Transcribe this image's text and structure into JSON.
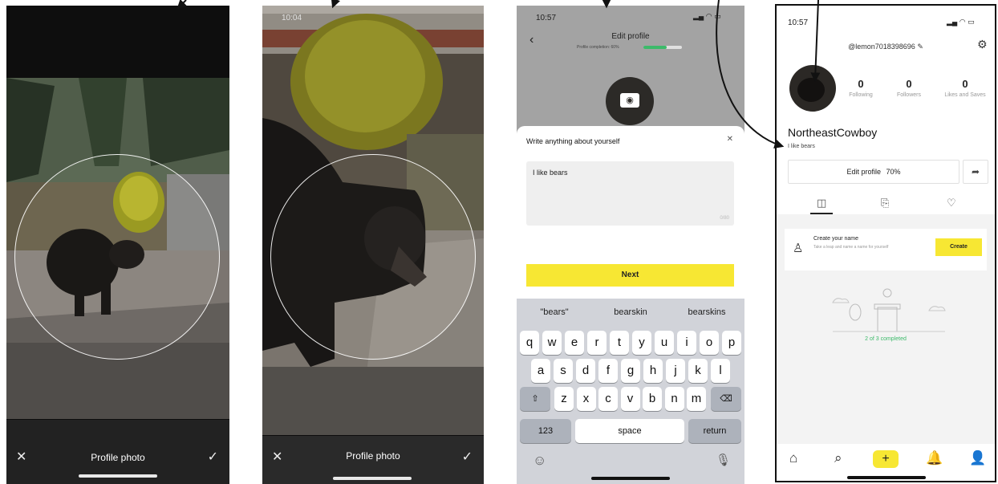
{
  "screen1": {
    "title": "Profile photo",
    "cancel_icon": "close-icon",
    "confirm_icon": "checkmark-icon"
  },
  "screen2": {
    "status_time": "10:04",
    "title": "Profile photo"
  },
  "screen3": {
    "status_time": "10:57",
    "header_title": "Edit profile",
    "header_subtitle": "Profile completion: 60%",
    "progress": 0.6,
    "sheet_title": "Write anything about yourself",
    "bio_value": "I like bears",
    "char_count": "0/80",
    "next_label": "Next",
    "suggestions": [
      "\"bears\"",
      "bearskin",
      "bearskins"
    ],
    "keys_row1": [
      "q",
      "w",
      "e",
      "r",
      "t",
      "y",
      "u",
      "i",
      "o",
      "p"
    ],
    "keys_row2": [
      "a",
      "s",
      "d",
      "f",
      "g",
      "h",
      "j",
      "k",
      "l"
    ],
    "keys_row3": [
      "z",
      "x",
      "c",
      "v",
      "b",
      "n",
      "m"
    ],
    "key_numbers": "123",
    "key_space": "space",
    "key_return": "return"
  },
  "screen4": {
    "status_time": "10:57",
    "username": "@lemon7018398696",
    "stats": [
      {
        "value": "0",
        "label": "Following"
      },
      {
        "value": "0",
        "label": "Followers"
      },
      {
        "value": "0",
        "label": "Likes and Saves"
      }
    ],
    "display_name": "NortheastCowboy",
    "bio": "I like bears",
    "edit_profile_label": "Edit profile",
    "edit_profile_pct": "70%",
    "task_title": "Create your name",
    "task_desc": "Take a leap and name a name for yourself",
    "create_label": "Create",
    "completion_text": "2 of 3 completed",
    "accent": "#f7e733",
    "green": "#3dba6a"
  }
}
